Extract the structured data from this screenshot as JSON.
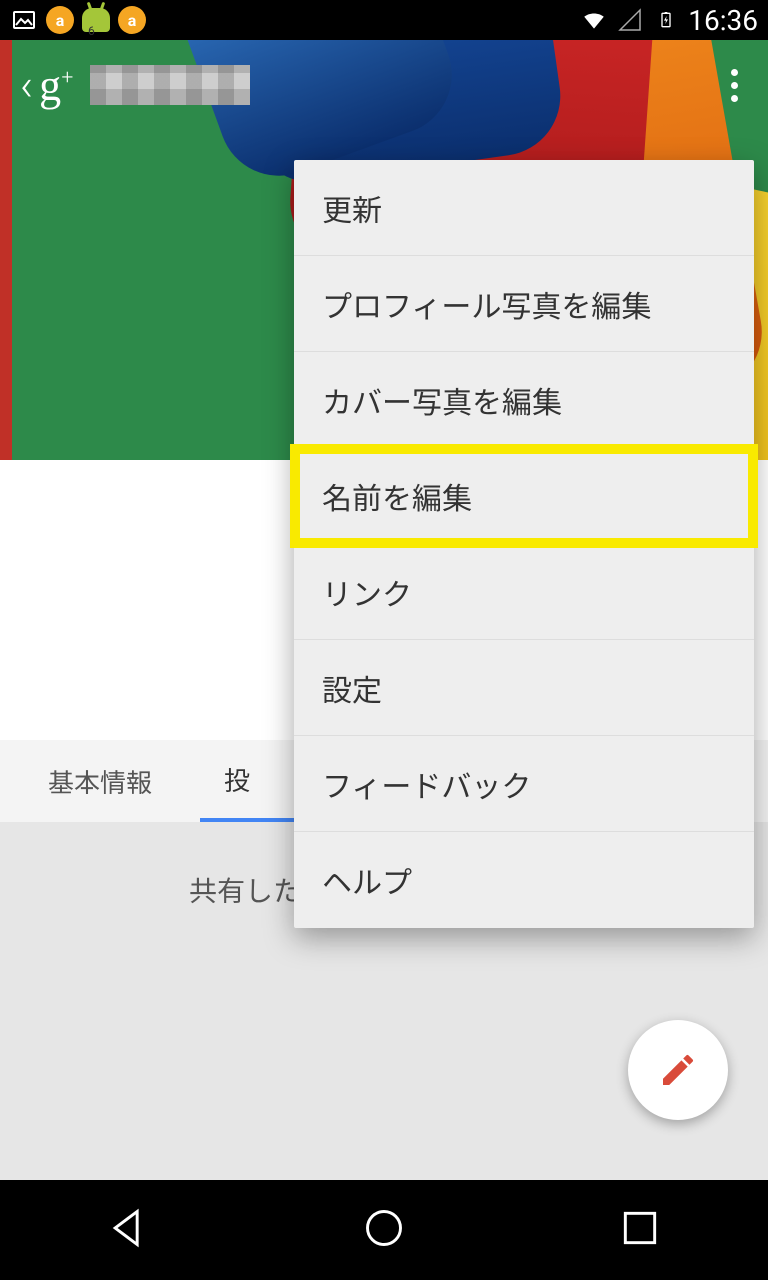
{
  "statusbar": {
    "badge_count": "6",
    "time": "16:36"
  },
  "actionbar": {
    "logo": "g+",
    "username": ""
  },
  "tabs": {
    "basic_info": "基本情報",
    "posts_partial": "投"
  },
  "empty_state": {
    "shared_partial": "共有した投"
  },
  "menu": {
    "items": [
      "更新",
      "プロフィール写真を編集",
      "カバー写真を編集",
      "名前を編集",
      "リンク",
      "設定",
      "フィードバック",
      "ヘルプ"
    ],
    "highlighted_index": 3
  }
}
